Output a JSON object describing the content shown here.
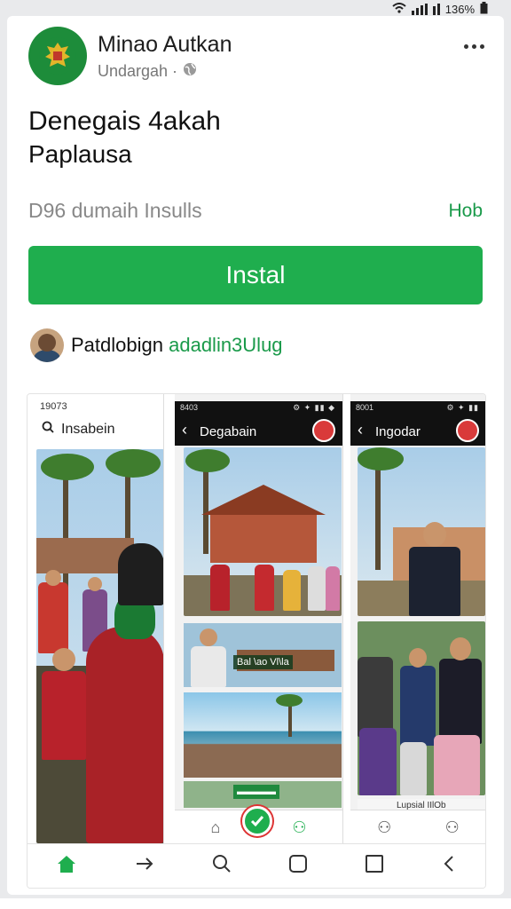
{
  "status_bar": {
    "battery": "136%"
  },
  "header": {
    "app_name": "Minao Autkan",
    "developer_line": "Undargah ·",
    "headline_1": "Denegais 4akah",
    "headline_2": "Paplausa",
    "meta": "D96 dumaih Insulls",
    "meta_link": "Hob",
    "install_label": "Instal",
    "developer_name_a": "Patdlobign",
    "developer_name_b": "adadlin3Ulug"
  },
  "screenshots": {
    "s1_time": "19073",
    "s1_search": "Insabein",
    "s2_time": "8403",
    "s2_title": "Degabain",
    "s2_thumb_label": "Bal \\ao Vl\\la",
    "s3_time": "8001",
    "s3_title": "Ingodar",
    "s3_footer_label": "Lupsial IIlOb"
  },
  "icons": [
    "wifi-icon",
    "signal-icon",
    "battery-icon",
    "more-icon",
    "globe-icon",
    "search-icon",
    "home-icon",
    "share-icon",
    "square-icon",
    "back-icon",
    "person-icon",
    "check-icon"
  ],
  "colors": {
    "accent": "#1fae4e",
    "link": "#1a9a4a",
    "record": "#d93a3a"
  }
}
